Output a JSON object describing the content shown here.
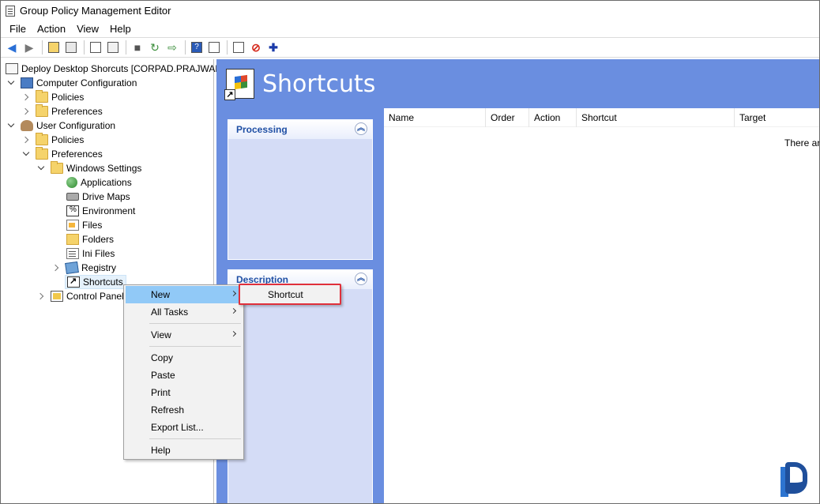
{
  "window": {
    "title": "Group Policy Management Editor"
  },
  "menubar": [
    "File",
    "Action",
    "View",
    "Help"
  ],
  "toolbar": {
    "icons": [
      "back-arrow-icon",
      "forward-arrow-icon",
      "up-folder-icon",
      "show-hide-tree-icon",
      "copy-icon",
      "paste-icon",
      "print-icon",
      "refresh-icon",
      "export-icon",
      "help-icon",
      "properties-icon",
      "new-item-icon",
      "stop-icon",
      "add-icon"
    ]
  },
  "tree": {
    "root": "Deploy Desktop Shorcuts [CORPAD.PRAJWAL",
    "computer_configuration": "Computer Configuration",
    "cc_policies": "Policies",
    "cc_preferences": "Preferences",
    "user_configuration": "User Configuration",
    "uc_policies": "Policies",
    "uc_preferences": "Preferences",
    "windows_settings": "Windows Settings",
    "applications": "Applications",
    "drive_maps": "Drive Maps",
    "environment": "Environment",
    "files": "Files",
    "folders": "Folders",
    "ini_files": "Ini Files",
    "registry": "Registry",
    "shortcuts": "Shortcuts",
    "control_panel": "Control Panel"
  },
  "right_pane": {
    "title": "Shortcuts",
    "processing_panel": "Processing",
    "description_panel": "Description",
    "columns": [
      "Name",
      "Order",
      "Action",
      "Shortcut",
      "Target"
    ],
    "empty_text": "There ar"
  },
  "context_menu": {
    "new": "New",
    "all_tasks": "All Tasks",
    "view": "View",
    "copy": "Copy",
    "paste": "Paste",
    "print": "Print",
    "refresh": "Refresh",
    "export_list": "Export List...",
    "help": "Help"
  },
  "submenu": {
    "shortcut": "Shortcut"
  },
  "colors": {
    "header_blue": "#6a8ee0",
    "highlight": "#91c9f7",
    "callout_red": "#e0303b"
  }
}
